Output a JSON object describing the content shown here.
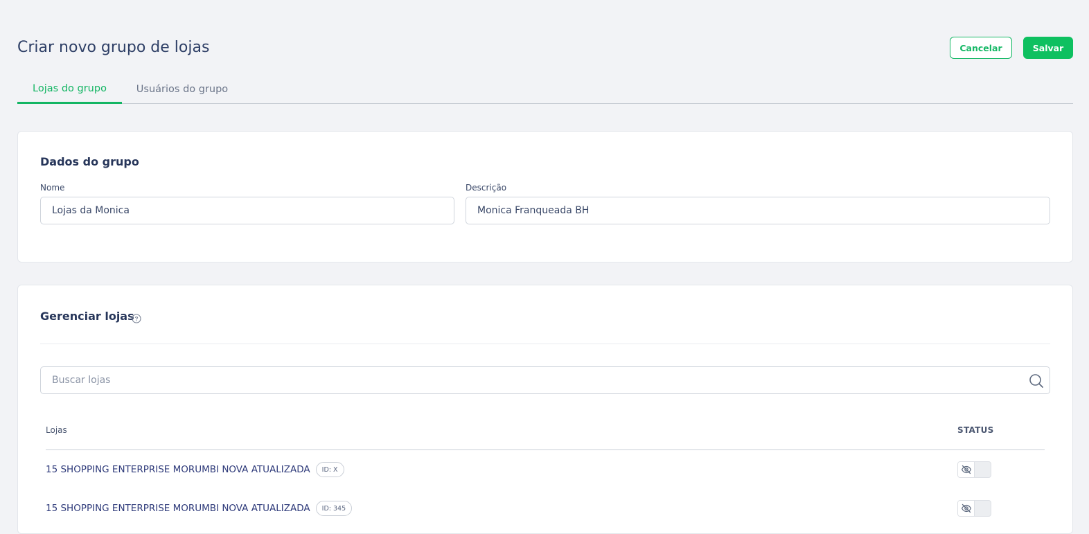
{
  "header": {
    "title": "Criar novo grupo de lojas",
    "cancel_label": "Cancelar",
    "save_label": "Salvar"
  },
  "tabs": [
    {
      "label": "Lojas do grupo",
      "active": true
    },
    {
      "label": "Usuários do grupo",
      "active": false
    }
  ],
  "group_data": {
    "title": "Dados do grupo",
    "name_label": "Nome",
    "name_value": "Lojas da Monica",
    "description_label": "Descrição",
    "description_value": "Monica Franqueada BH"
  },
  "manage_stores": {
    "title": "Gerenciar lojas",
    "help_icon": "question-circle-icon",
    "search": {
      "placeholder": "Buscar lojas",
      "icon": "search-icon"
    },
    "table": {
      "columns": [
        "Lojas",
        "STATUS"
      ],
      "rows": [
        {
          "name": "15 SHOPPING ENTERPRISE MORUMBI NOVA ATUALIZADA",
          "id_badge": "ID: X",
          "status_icon": "eye-off-icon",
          "status_on": false
        },
        {
          "name": "15 SHOPPING ENTERPRISE MORUMBI NOVA ATUALIZADA",
          "id_badge": "ID: 345",
          "status_icon": "eye-off-icon",
          "status_on": false
        }
      ]
    }
  },
  "colors": {
    "accent": "#13b563",
    "save_bg": "#0ec060",
    "title": "#2e3f66",
    "store_name": "#2e3a7a",
    "page_bg": "#f2f3f6"
  }
}
